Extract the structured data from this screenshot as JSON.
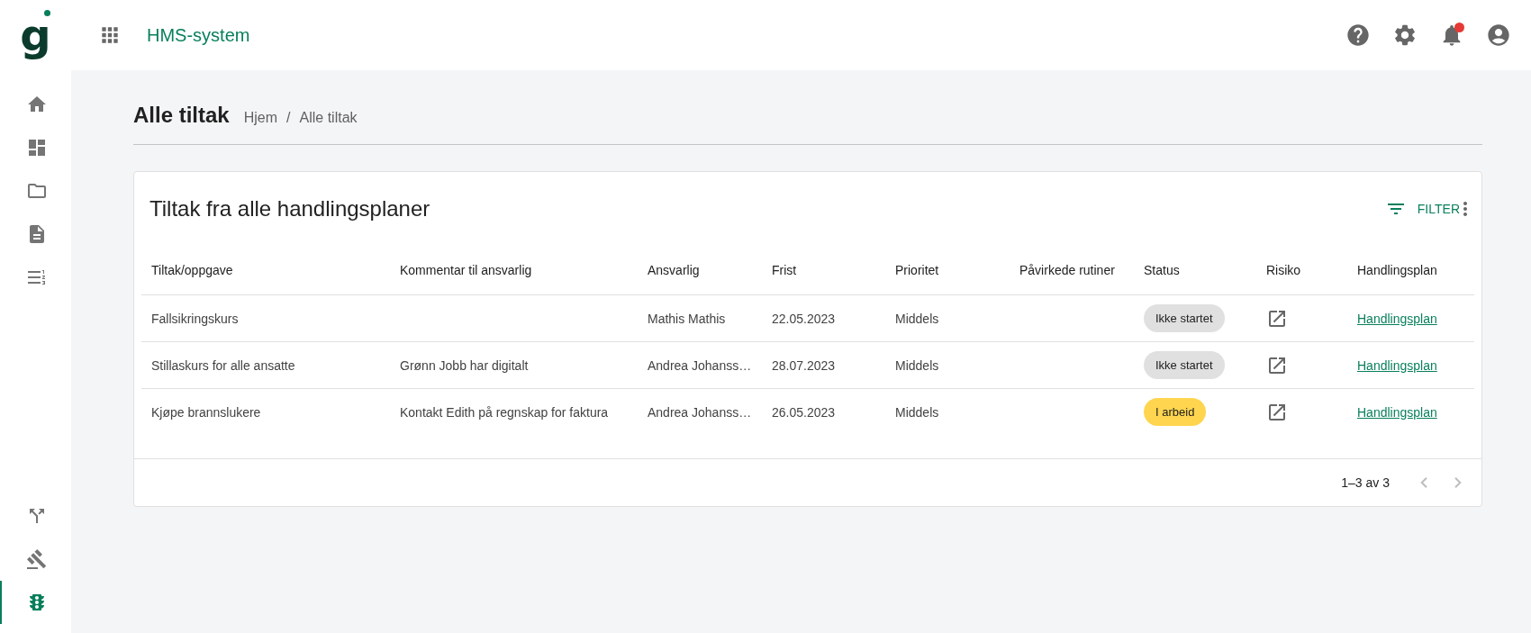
{
  "logo": {
    "text": "g"
  },
  "app_title": "HMS-system",
  "notifications": {
    "unread": true
  },
  "sidebar": {
    "top_items": [
      {
        "selected": false
      },
      {
        "selected": false
      },
      {
        "selected": false
      },
      {
        "selected": false
      },
      {
        "selected": false
      }
    ],
    "bottom_items": [
      {
        "selected": false
      },
      {
        "selected": false
      },
      {
        "selected": true
      }
    ]
  },
  "page": {
    "title": "Alle tiltak",
    "breadcrumb": [
      "Hjem",
      "Alle tiltak"
    ],
    "separator": "/"
  },
  "card": {
    "title": "Tiltak fra alle handlingsplaner",
    "filter_label": "FILTER"
  },
  "table": {
    "columns": [
      "Tiltak/oppgave",
      "Kommentar til ansvarlig",
      "Ansvarlig",
      "Frist",
      "Prioritet",
      "Påvirkede rutiner",
      "Status",
      "Risiko",
      "Handlingsplan"
    ],
    "rows": [
      {
        "task": "Fallsikringskurs",
        "comment": "",
        "responsible": "Mathis Mathis",
        "deadline": "22.05.2023",
        "priority": "Middels",
        "routines": "",
        "status": {
          "label": "Ikke startet",
          "color": "#e0e0e0"
        },
        "plan_link": "Handlingsplan"
      },
      {
        "task": "Stillaskurs for alle ansatte",
        "comment": "Grønn Jobb har digitalt",
        "responsible": "Andrea Johanss…",
        "deadline": "28.07.2023",
        "priority": "Middels",
        "routines": "",
        "status": {
          "label": "Ikke startet",
          "color": "#e0e0e0"
        },
        "plan_link": "Handlingsplan"
      },
      {
        "task": "Kjøpe brannslukere",
        "comment": "Kontakt Edith på regnskap for faktura",
        "responsible": "Andrea Johanss…",
        "deadline": "26.05.2023",
        "priority": "Middels",
        "routines": "",
        "status": {
          "label": "I arbeid",
          "color": "#ffd54f"
        },
        "plan_link": "Handlingsplan"
      }
    ]
  },
  "pagination": {
    "range": "1–3 av 3",
    "prev_disabled": true,
    "next_disabled": true
  }
}
